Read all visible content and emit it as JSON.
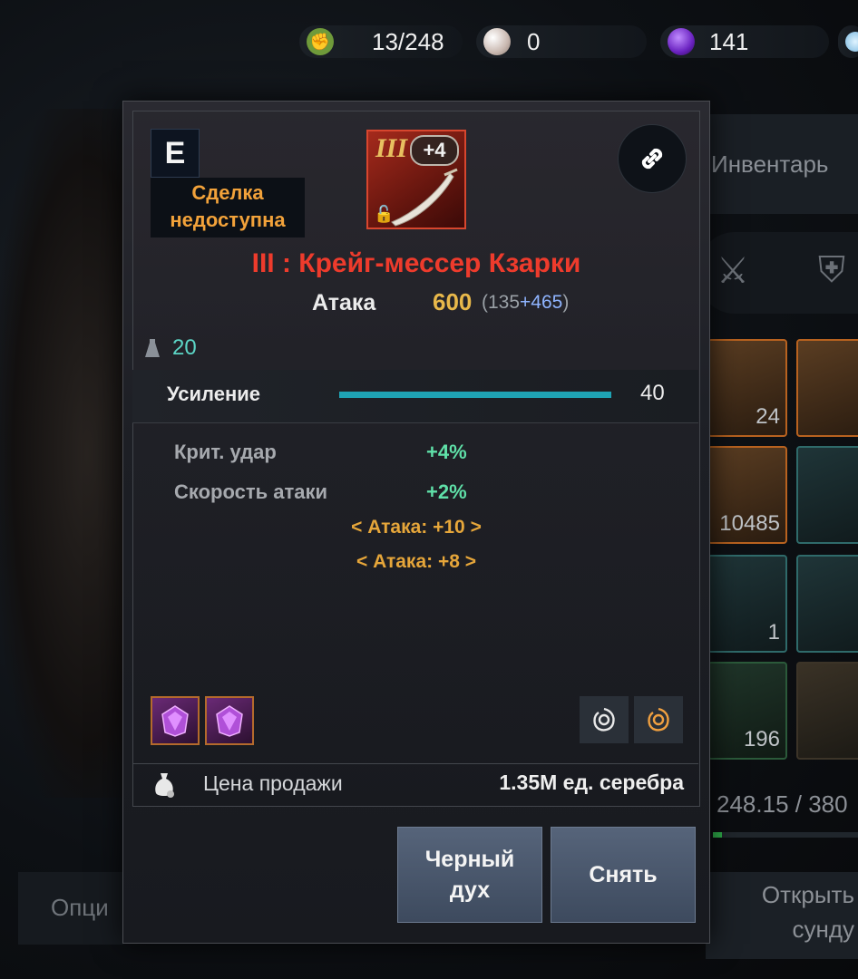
{
  "top_bar": {
    "energy": "13/248",
    "pearls": "0",
    "crystals": "141"
  },
  "background": {
    "inventory_tab": "Инвентарь",
    "slots": [
      "24",
      "10485",
      "1",
      "196"
    ],
    "weight": "248.15 / 380",
    "open_chest_button": "Открыть сунду",
    "options_button": "Опци"
  },
  "tooltip": {
    "grade": "E",
    "trade_status": "Сделка недоступна",
    "icon_tier": "III",
    "icon_enhance": "+4",
    "item_name": "III : Крейг-мессер Кзарки",
    "attack_label": "Атака",
    "attack_value": "600",
    "attack_base": "(135",
    "attack_bonus": "+465",
    "attack_close": ")",
    "weight": "20",
    "enhance_label": "Усиление",
    "enhance_value": "40",
    "enhance_progress": 1.0,
    "stats": [
      {
        "name": "Крит. удар",
        "value": "+4%"
      },
      {
        "name": "Скорость атаки",
        "value": "+2%"
      }
    ],
    "bonuses": [
      "< Атака: +10 >",
      "< Атака: +8 >"
    ],
    "sell_label": "Цена продажи",
    "sell_value": "1.35M ед. серебра",
    "black_spirit_button": "Черный дух",
    "remove_button": "Снять"
  },
  "colors": {
    "item_name": "#ee3b2c",
    "trade_status": "#f2a23a",
    "stat_value": "#5fe0a8",
    "bonus": "#e6a63a",
    "enhance_bar": "#1fa3b4"
  }
}
